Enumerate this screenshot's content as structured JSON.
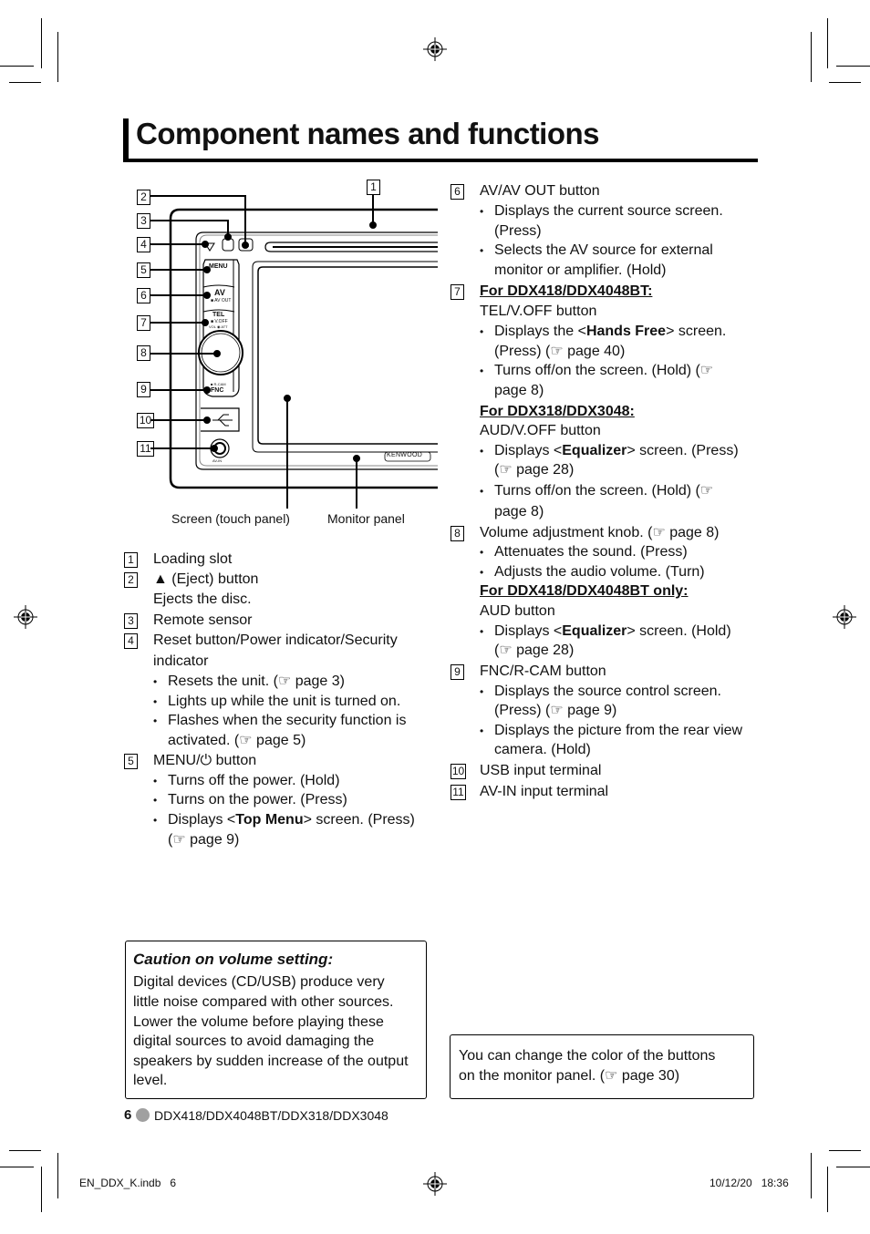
{
  "page": {
    "title": "Component names and functions",
    "footer_page_number": "6",
    "footer_models": "DDX418/DDX4048BT/DDX318/DDX3048",
    "slug_file": "EN_DDX_K.indb   6",
    "slug_date": "10/12/20   18:36"
  },
  "diagram": {
    "callouts": [
      "1",
      "2",
      "3",
      "4",
      "5",
      "6",
      "7",
      "8",
      "9",
      "10",
      "11"
    ],
    "panel_labels": {
      "menu": "MENU",
      "av": "AV",
      "av_out": "■ AV OUT",
      "tel": "TEL",
      "voff": "■ V.OFF",
      "vol_att": "VOL ◉ ATT",
      "aud": "■ AUD",
      "rcam": "■ R-CAM",
      "fnc": "FNC",
      "avin": "AV-IN",
      "brand": "KENWOOD"
    },
    "caption_screen": "Screen (touch panel)",
    "caption_monitor": "Monitor panel"
  },
  "left_list": [
    {
      "n": "1",
      "text": "Loading slot"
    },
    {
      "n": "2",
      "text": "▲ (Eject) button",
      "sub": "Ejects the disc."
    },
    {
      "n": "3",
      "text": "Remote sensor"
    },
    {
      "n": "4",
      "text": "Reset button/Power indicator/Security",
      "text2": "indicator",
      "bullets": [
        "Resets the unit. (☞ page 3)",
        "Lights up while the unit is turned on.",
        "Flashes when the security function is",
        "activated. (☞ page 5)"
      ]
    },
    {
      "n": "5",
      "text": "MENU/⏻ button",
      "bullets": [
        "Turns off the power. (Hold)",
        "Turns on the power. (Press)"
      ],
      "b3_pre": "Displays <",
      "b3_bold": "Top Menu",
      "b3_post": "> screen. (Press)",
      "b3_cont": "(☞ page 9)"
    }
  ],
  "right_list": {
    "item6": {
      "n": "6",
      "text": "AV/AV OUT button",
      "b1": "Displays the current source screen.",
      "b1c": "(Press)",
      "b2": "Selects the AV source for external",
      "b2c": "monitor or amplifier. (Hold)"
    },
    "item7": {
      "n": "7",
      "hdr1": "For DDX418/DDX4048BT:",
      "text1": "TEL/V.OFF button",
      "b1_pre": "Displays the <",
      "b1_bold": "Hands Free",
      "b1_post": "> screen.",
      "b1c": "(Press) (☞ page 40)",
      "b2": "Turns off/on the screen. (Hold) (☞",
      "b2c": "page 8)",
      "hdr2": "For DDX318/DDX3048:",
      "text2": "AUD/V.OFF button",
      "b3_pre": "Displays <",
      "b3_bold": "Equalizer",
      "b3_post": "> screen. (Press)",
      "b3c": "(☞ page 28)",
      "b4": "Turns off/on the screen. (Hold) (☞",
      "b4c": "page 8)"
    },
    "item8": {
      "n": "8",
      "text": "Volume adjustment knob. (☞ page 8)",
      "b1": "Attenuates the sound. (Press)",
      "b2": "Adjusts the audio volume. (Turn)",
      "hdr": "For DDX418/DDX4048BT only:",
      "text2": "AUD button",
      "b3_pre": "Displays <",
      "b3_bold": "Equalizer",
      "b3_post": "> screen. (Hold)",
      "b3c": "(☞ page 28)"
    },
    "item9": {
      "n": "9",
      "text": "FNC/R-CAM button",
      "b1": "Displays the source control screen.",
      "b1c": "(Press) (☞ page 9)",
      "b2": "Displays the picture from the rear view",
      "b2c": "camera. (Hold)"
    },
    "item10": {
      "n": "10",
      "text": "USB input terminal"
    },
    "item11": {
      "n": "11",
      "text": "AV-IN input terminal"
    }
  },
  "caution": {
    "title": "Caution on volume setting:",
    "lines": [
      "Digital devices (CD/USB) produce very",
      "little noise compared with other sources.",
      "Lower the volume before playing these",
      "digital sources to avoid damaging the",
      "speakers by sudden increase of the output",
      "level."
    ]
  },
  "note": {
    "lines": [
      "You can change the color of the buttons",
      "on the monitor panel.  (☞ page 30)"
    ]
  }
}
